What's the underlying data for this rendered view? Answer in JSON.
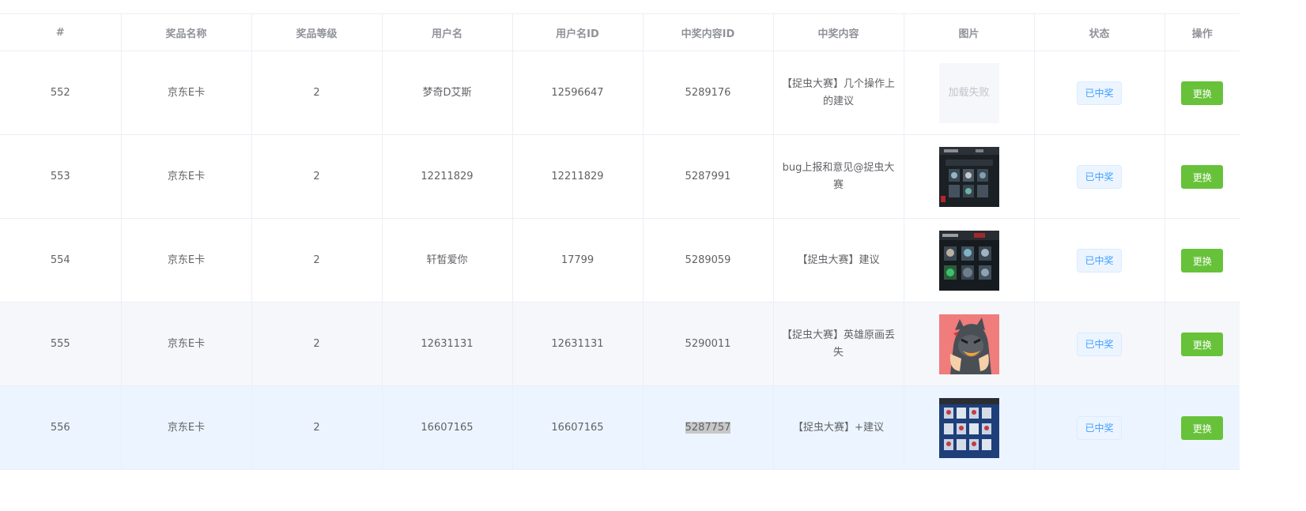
{
  "table": {
    "headers": [
      "#",
      "奖品名称",
      "奖品等级",
      "用户名",
      "用户名ID",
      "中奖内容ID",
      "中奖内容",
      "图片",
      "状态",
      "操作"
    ],
    "rows": [
      {
        "id": "552",
        "prize_name": "京东E卡",
        "prize_level": "2",
        "username": "梦奇D艾斯",
        "user_id": "12596647",
        "content_id": "5289176",
        "content": "【捉虫大赛】几个操作上的建议",
        "image": "load-failed",
        "image_text": "加载失败",
        "status": "已中奖",
        "action": "更换"
      },
      {
        "id": "553",
        "prize_name": "京东E卡",
        "prize_level": "2",
        "username": "12211829",
        "user_id": "12211829",
        "content_id": "5287991",
        "content": "bug上报和意见@捉虫大赛",
        "image": "game-screenshot-dark",
        "status": "已中奖",
        "action": "更换"
      },
      {
        "id": "554",
        "prize_name": "京东E卡",
        "prize_level": "2",
        "username": "轩皙爱你",
        "user_id": "17799",
        "content_id": "5289059",
        "content": "【捉虫大赛】建议",
        "image": "game-screenshot-green",
        "status": "已中奖",
        "action": "更换"
      },
      {
        "id": "555",
        "prize_name": "京东E卡",
        "prize_level": "2",
        "username": "12631131",
        "user_id": "12631131",
        "content_id": "5290011",
        "content": "【捉虫大赛】英雄原画丢失",
        "image": "cartoon-avatar",
        "status": "已中奖",
        "action": "更换"
      },
      {
        "id": "556",
        "prize_name": "京东E卡",
        "prize_level": "2",
        "username": "16607165",
        "user_id": "16607165",
        "content_id": "5287757",
        "content": "【捉虫大赛】+建议",
        "image": "game-screenshot-blue",
        "status": "已中奖",
        "action": "更换"
      }
    ]
  },
  "colors": {
    "header_text": "#909399",
    "cell_text": "#606266",
    "border": "#ebeef5",
    "status_tag": "#409eff",
    "change_button": "#67c23a",
    "hover_row": "#ecf5ff",
    "striped_row": "#f5f7fa"
  }
}
